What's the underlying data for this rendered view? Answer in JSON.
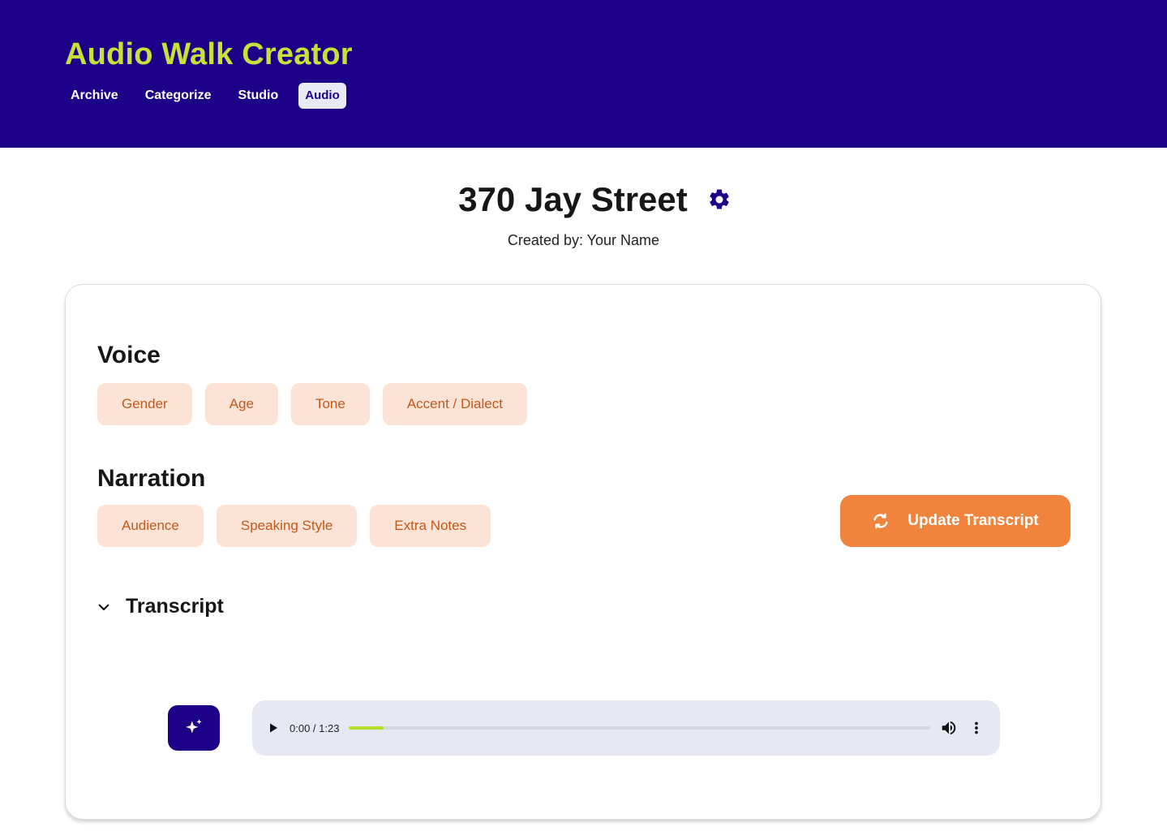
{
  "app": {
    "title": "Audio Walk Creator",
    "nav": [
      {
        "label": "Archive",
        "active": false
      },
      {
        "label": "Categorize",
        "active": false
      },
      {
        "label": "Studio",
        "active": false
      },
      {
        "label": "Audio",
        "active": true
      }
    ]
  },
  "page": {
    "title": "370 Jay Street",
    "creator_prefix": "Created by:",
    "creator_name": "Your Name",
    "settings_icon": "gear-icon"
  },
  "voice": {
    "title": "Voice",
    "options": [
      "Gender",
      "Age",
      "Tone",
      "Accent / Dialect"
    ]
  },
  "narration": {
    "title": "Narration",
    "options": [
      "Audience",
      "Speaking Style",
      "Extra Notes"
    ]
  },
  "update_button": {
    "label": "Update Transcript",
    "icon": "refresh-icon"
  },
  "transcript": {
    "label": "Transcript",
    "icon": "chevron-down-icon"
  },
  "player": {
    "time": "0:00 / 1:23",
    "progress_fraction": 0.06,
    "generate_icon": "sparkle-icon"
  },
  "colors": {
    "header_bg": "#1c0087",
    "title_accent": "#c6e23a",
    "chip_bg": "#fde3d6",
    "chip_text": "#c2591a",
    "button_orange": "#f0843c",
    "progress": "#b5e02a"
  }
}
